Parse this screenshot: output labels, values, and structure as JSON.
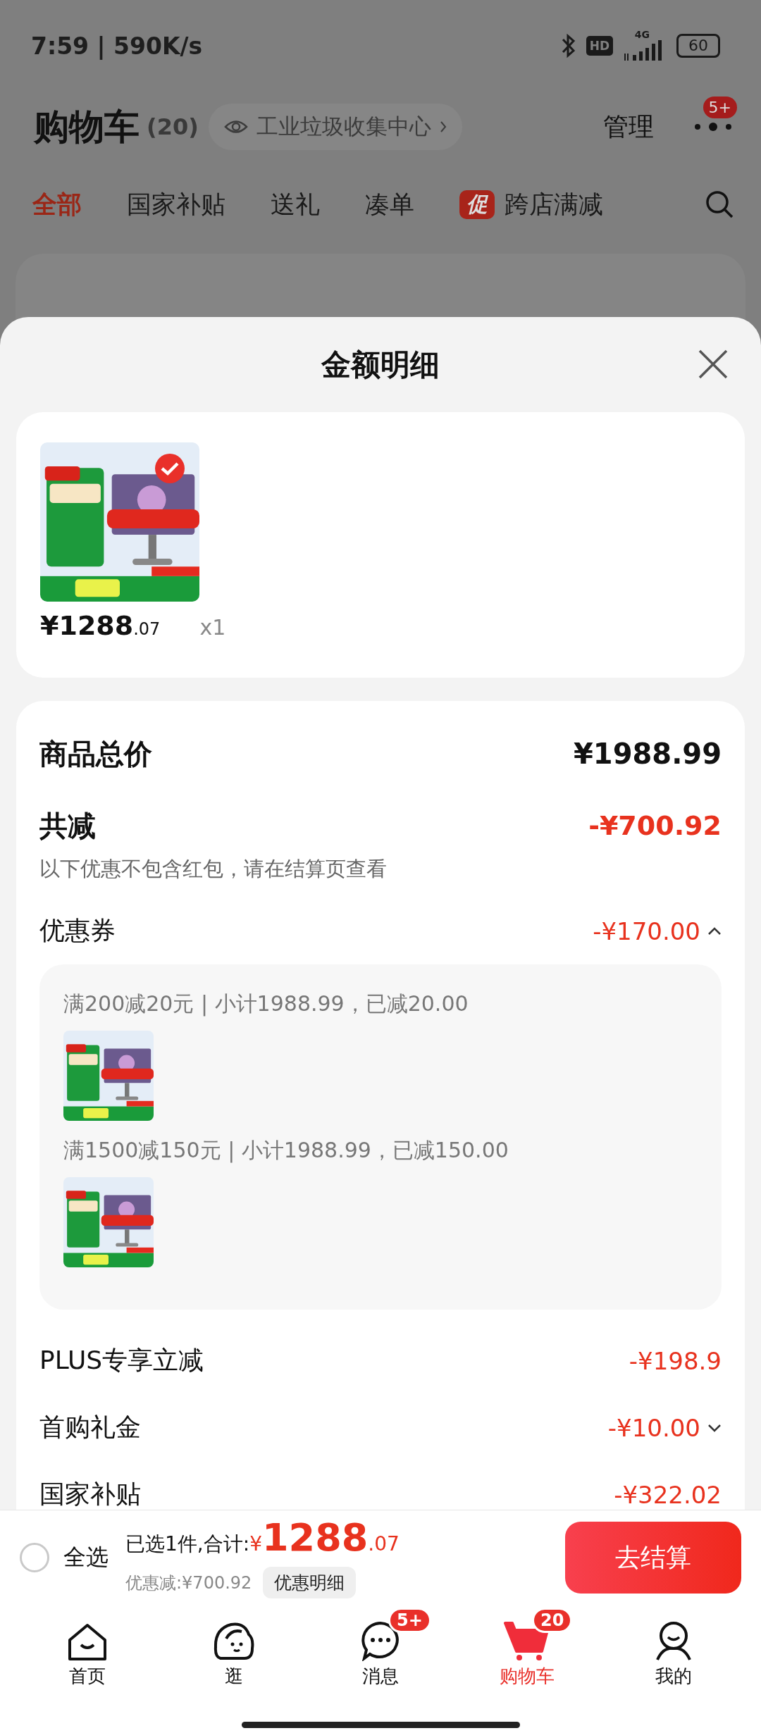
{
  "status_bar": {
    "time": "7:59 | 590K/s",
    "hd": "HD",
    "network": "4G",
    "battery": "60"
  },
  "header": {
    "title": "购物车",
    "count": "(20)",
    "address": "工业垃圾收集中心",
    "manage": "管理",
    "more_badge": "5+"
  },
  "tabs": [
    {
      "label": "全部",
      "selected": true
    },
    {
      "label": "国家补贴",
      "selected": false
    },
    {
      "label": "送礼",
      "selected": false
    },
    {
      "label": "凑单",
      "selected": false
    },
    {
      "label": "跨店满减",
      "selected": false,
      "badge": "促"
    }
  ],
  "sheet": {
    "title": "金额明细",
    "product": {
      "kind": "picture",
      "selected": true,
      "price": "¥1288",
      "price_decimals": ".07",
      "quantity": "x1"
    },
    "rows": [
      {
        "kind": "total",
        "label": "商品总价",
        "value": "¥1988.99"
      },
      {
        "kind": "discount",
        "label": "共减",
        "value": "-¥700.92",
        "note": "以下优惠不包含红包，请在结算页查看"
      },
      {
        "kind": "item",
        "label": "优惠券",
        "value": "-¥170.00",
        "expanded": true,
        "groups": [
          {
            "text": "满200减20元 | 小计1988.99，已减20.00"
          },
          {
            "text": "满1500减150元 | 小计1988.99，已减150.00"
          }
        ]
      },
      {
        "kind": "item",
        "label": "PLUS专享立减",
        "value": "-¥198.9"
      },
      {
        "kind": "item",
        "label": "首购礼金",
        "value": "-¥10.00",
        "expanded": false
      },
      {
        "kind": "item",
        "label": "国家补贴",
        "value": "-¥322.02"
      }
    ]
  },
  "checkout_bar": {
    "select_all": {
      "label": "全选",
      "checked": false
    },
    "summary": "已选1件,合计:",
    "currency": "¥",
    "total": "1288",
    "total_decimals": ".07",
    "saved": "优惠减:¥700.92",
    "details_button": "优惠明细",
    "checkout_button": "去结算"
  },
  "bottom_nav": [
    {
      "label": "首页",
      "selected": false
    },
    {
      "label": "逛",
      "selected": false
    },
    {
      "label": "消息",
      "selected": false,
      "badge": "5+"
    },
    {
      "label": "购物车",
      "selected": true,
      "badge": "20"
    },
    {
      "label": "我的",
      "selected": false
    }
  ]
}
